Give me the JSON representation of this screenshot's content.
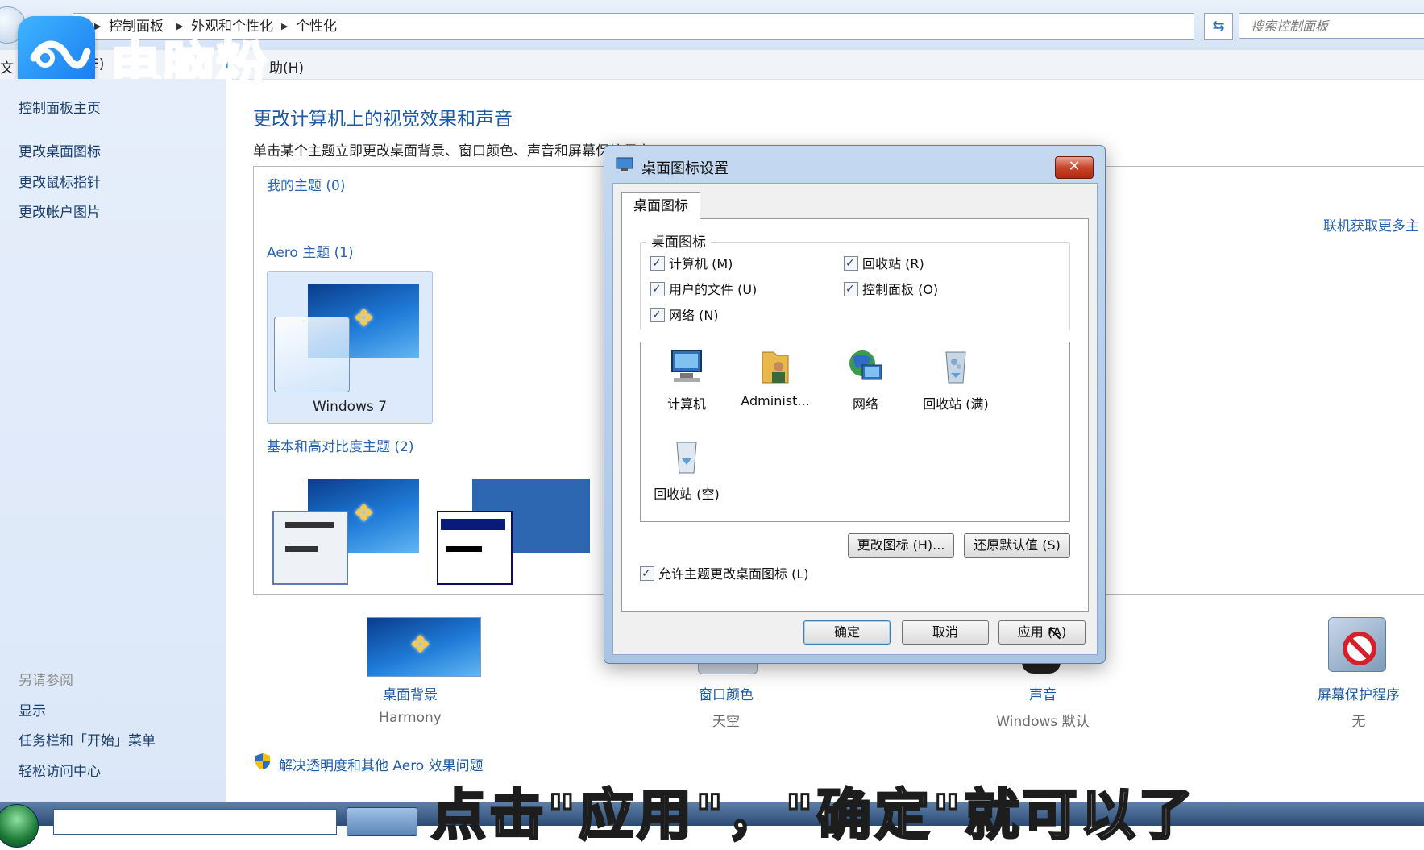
{
  "address_bar": {
    "crumbs": [
      "控制面板",
      "外观和个性化",
      "个性化"
    ],
    "search_placeholder": "搜索控制面板"
  },
  "watermark": {
    "text": "电脑粉"
  },
  "menu_bar": {
    "items": [
      "文",
      "E)",
      "助(H)"
    ]
  },
  "sidebar": {
    "links": [
      "控制面板主页",
      "更改桌面图标",
      "更改鼠标指针",
      "更改帐户图片"
    ],
    "see_also_heading": "另请参阅",
    "see_also": [
      "显示",
      "任务栏和「开始」菜单",
      "轻松访问中心"
    ]
  },
  "main": {
    "title": "更改计算机上的视觉效果和声音",
    "description": "单击某个主题立即更改桌面背景、窗口颜色、声音和屏幕保护程序。",
    "groups": {
      "my_themes": "我的主题 (0)",
      "aero_themes": "Aero 主题 (1)",
      "basic_themes": "基本和高对比度主题 (2)"
    },
    "get_more": "联机获取更多主",
    "theme_windows7": "Windows 7",
    "tiles": [
      {
        "label": "桌面背景",
        "sub": "Harmony"
      },
      {
        "label": "窗口颜色",
        "sub": "天空"
      },
      {
        "label": "声音",
        "sub": "Windows 默认"
      },
      {
        "label": "屏幕保护程序",
        "sub": "无"
      }
    ],
    "aero_link": "解决透明度和其他 Aero 效果问题"
  },
  "dialog": {
    "title": "桌面图标设置",
    "close_glyph": "✕",
    "tab": "桌面图标",
    "group_title": "桌面图标",
    "checkboxes": [
      {
        "label": "计算机 (M)",
        "checked": true
      },
      {
        "label": "回收站 (R)",
        "checked": true
      },
      {
        "label": "用户的文件 (U)",
        "checked": true
      },
      {
        "label": "控制面板 (O)",
        "checked": true
      },
      {
        "label": "网络 (N)",
        "checked": true
      }
    ],
    "icons": [
      {
        "label": "计算机",
        "icon": "computer-icon"
      },
      {
        "label": "Administ...",
        "icon": "user-folder-icon"
      },
      {
        "label": "网络",
        "icon": "network-icon"
      },
      {
        "label": "回收站 (满)",
        "icon": "recycle-bin-full-icon"
      },
      {
        "label": "回收站 (空)",
        "icon": "recycle-bin-empty-icon"
      }
    ],
    "change_icon_button": "更改图标 (H)...",
    "restore_default_button": "还原默认值 (S)",
    "allow_themes_checkbox": "允许主题更改桌面图标 (L)",
    "ok_button": "确定",
    "cancel_button": "取消",
    "apply_button": "应用 (A)"
  },
  "subtitle": "点击\"应用\"，\"确定\"就可以了",
  "colors": {
    "link_blue": "#1d5aa6",
    "sidebar_bg": "#dbe7f8",
    "dialog_frame": "#a9c4e4"
  }
}
